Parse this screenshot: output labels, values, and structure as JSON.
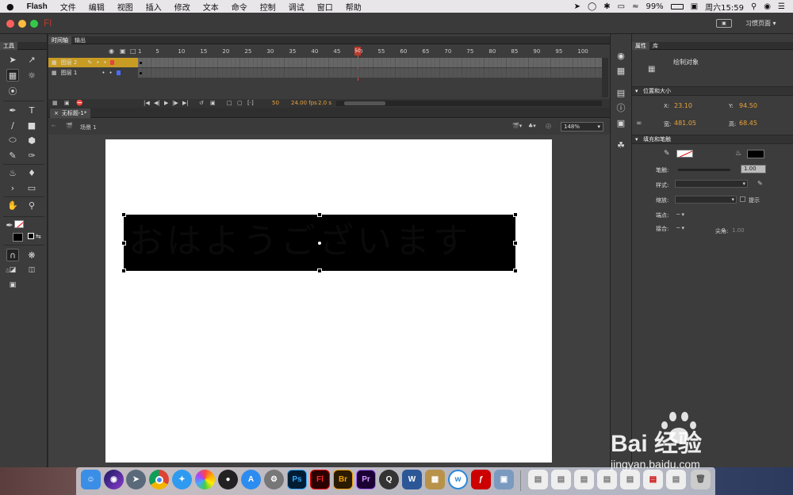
{
  "menubar": {
    "apple": "",
    "app_name": "Flash",
    "items": [
      "文件",
      "编辑",
      "视图",
      "插入",
      "修改",
      "文本",
      "命令",
      "控制",
      "调试",
      "窗口",
      "帮助"
    ],
    "battery": "99%",
    "clock": "周六15:59"
  },
  "titlebar": {
    "logo": "Fl",
    "workspace_label": "习惯页面",
    "workspace_chevron": "▾"
  },
  "tools_panel": {
    "tab": "工具"
  },
  "timeline": {
    "tabs": [
      "时间轴",
      "输出"
    ],
    "ruler": [
      "1",
      "5",
      "10",
      "15",
      "20",
      "25",
      "30",
      "35",
      "40",
      "45",
      "50",
      "55",
      "60",
      "65",
      "70",
      "75",
      "80",
      "85",
      "90",
      "95",
      "100"
    ],
    "layers": [
      {
        "name": "图层 2",
        "selected": true,
        "color": "#e84040"
      },
      {
        "name": "图层 1",
        "selected": false,
        "color": "#4a6cff"
      }
    ],
    "current_frame": "50",
    "fps": "24.00 fps",
    "time": "2.0 s"
  },
  "document": {
    "tab_title": "无标题-1*",
    "scene": "场景 1",
    "zoom": "148%",
    "stage_text": "おはようございます"
  },
  "properties": {
    "tabs": [
      "属性",
      "库"
    ],
    "object_type": "绘制对象",
    "position_section": "位置和大小",
    "x_label": "X:",
    "x": "23.10",
    "y_label": "Y:",
    "y": "94.50",
    "w_label": "宽:",
    "w": "481.05",
    "h_label": "高:",
    "h": "68.45",
    "fill_section": "填充和笔触",
    "stroke_label": "笔触:",
    "stroke_value": "1.00",
    "style_label": "样式:",
    "scale_label": "缩放:",
    "hint_label": "提示",
    "cap_label": "端点:",
    "join_label": "接合:",
    "miter_label": "尖角:",
    "miter_value": "1.00",
    "fill_color": "#000000"
  },
  "dock": {
    "apps": [
      "Finder",
      "Siri",
      "Launchpad",
      "Chrome",
      "Safari",
      "Photos",
      "QQ",
      "App Store",
      "System Preferences",
      "Ps",
      "Fl",
      "Br",
      "Pr",
      "QuickTime",
      "Word",
      "Archive",
      "Wunderlist",
      "Flash Player",
      "Preview"
    ]
  },
  "watermark": {
    "brand": "Bai 经验",
    "url": "jingyan.baidu.com"
  }
}
